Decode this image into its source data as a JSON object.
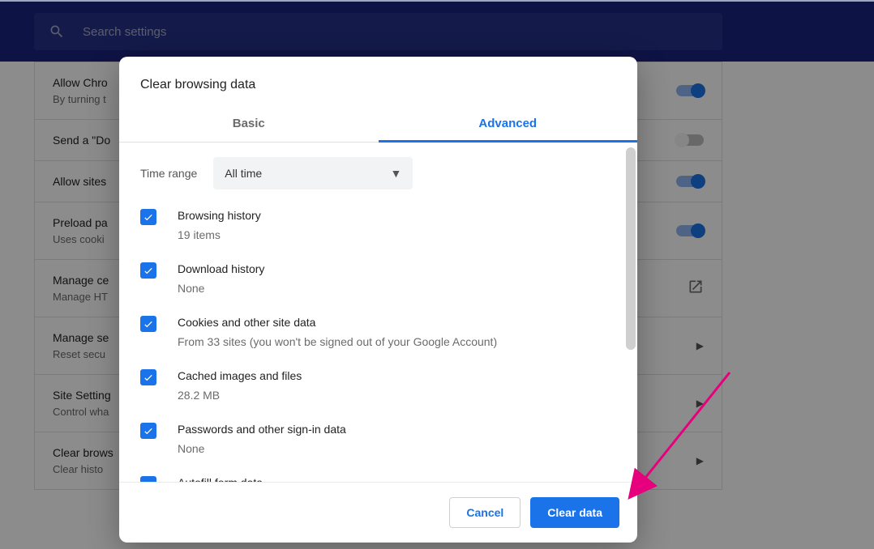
{
  "search": {
    "placeholder": "Search settings"
  },
  "bg_rows": [
    {
      "title": "Allow Chro",
      "sub": "By turning t",
      "ctrl": "toggle-on"
    },
    {
      "title": "Send a \"Do",
      "sub": "",
      "ctrl": "toggle-off"
    },
    {
      "title": "Allow sites",
      "sub": "",
      "ctrl": "toggle-on"
    },
    {
      "title": "Preload pa",
      "sub": "Uses cooki",
      "ctrl": "toggle-on"
    },
    {
      "title": "Manage ce",
      "sub": "Manage HT",
      "ctrl": "external"
    },
    {
      "title": "Manage se",
      "sub": "Reset secu",
      "ctrl": "chevron"
    },
    {
      "title": "Site Setting",
      "sub": "Control wha",
      "ctrl": "chevron"
    },
    {
      "title": "Clear brows",
      "sub": "Clear histo",
      "ctrl": "chevron"
    }
  ],
  "dialog": {
    "title": "Clear browsing data",
    "tabs": {
      "basic": "Basic",
      "advanced": "Advanced",
      "active": "advanced"
    },
    "timerange": {
      "label": "Time range",
      "value": "All time"
    },
    "items": [
      {
        "title": "Browsing history",
        "sub": "19 items",
        "checked": true
      },
      {
        "title": "Download history",
        "sub": "None",
        "checked": true
      },
      {
        "title": "Cookies and other site data",
        "sub": "From 33 sites (you won't be signed out of your Google Account)",
        "checked": true
      },
      {
        "title": "Cached images and files",
        "sub": "28.2 MB",
        "checked": true
      },
      {
        "title": "Passwords and other sign-in data",
        "sub": "None",
        "checked": true
      },
      {
        "title": "Autofill form data",
        "sub": "",
        "checked": true
      }
    ],
    "buttons": {
      "cancel": "Cancel",
      "clear": "Clear data"
    }
  }
}
